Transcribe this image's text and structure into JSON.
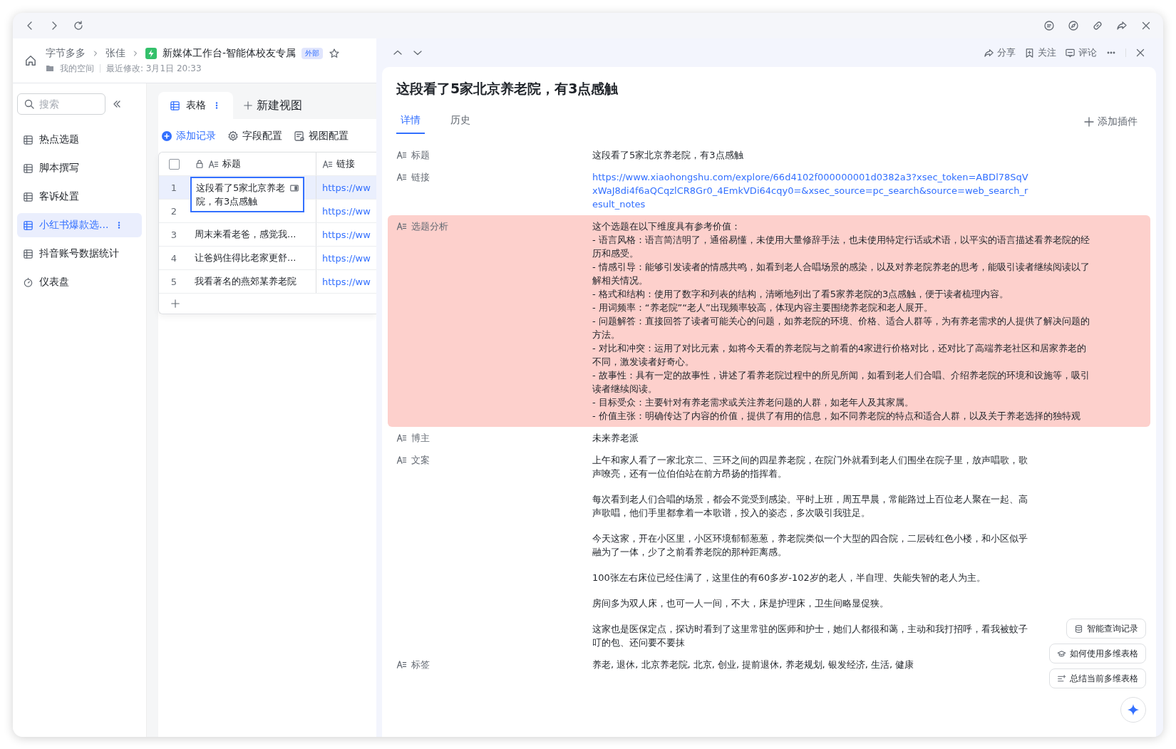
{
  "breadcrumb": {
    "items": [
      "字节多多",
      "张佳",
      "新媒体工作台-智能体校友专属"
    ],
    "badge": "外部",
    "location": "我的空间",
    "modified": "最近修改: 3月1日 20:33"
  },
  "sidebar": {
    "search": {
      "placeholder": "搜索"
    },
    "items": [
      {
        "label": "热点选题",
        "kind": "table",
        "selected": false
      },
      {
        "label": "脚本撰写",
        "kind": "table",
        "selected": false
      },
      {
        "label": "客诉处置",
        "kind": "table",
        "selected": false
      },
      {
        "label": "小红书爆款选...",
        "kind": "table",
        "selected": true
      },
      {
        "label": "抖音账号数据统计",
        "kind": "table",
        "selected": false
      },
      {
        "label": "仪表盘",
        "kind": "dashboard",
        "selected": false
      }
    ]
  },
  "views": [
    {
      "label": "表格",
      "selected": true
    }
  ],
  "new_view": "新建视图",
  "toolbar": [
    {
      "label": "添加记录",
      "kind": "add"
    },
    {
      "label": "字段配置",
      "kind": "fields"
    },
    {
      "label": "视图配置",
      "kind": "view"
    }
  ],
  "table": {
    "select_all": {
      "checked": false
    },
    "columns": [
      "标题",
      "链接"
    ],
    "rows": [
      {
        "number": "1",
        "title": "这段看了5家北京养老院，有3点感触",
        "link": "https://ww",
        "selected": true
      },
      {
        "number": "2",
        "link": "https://ww",
        "selected": false
      },
      {
        "number": "3",
        "title": "周末来看老爸，感觉我...",
        "link": "https://ww",
        "selected": false
      },
      {
        "number": "4",
        "title": "让爸妈住得比老家更舒...",
        "link": "https://ww",
        "selected": false
      },
      {
        "number": "5",
        "title": "我看著名的燕郊某养老院",
        "link": "https://ww",
        "selected": false
      }
    ]
  },
  "detail": {
    "actions": [
      "分享",
      "关注",
      "评论"
    ],
    "title": "这段看了5家北京养老院，有3点感触",
    "tabs": [
      {
        "label": "详情",
        "selected": true
      },
      {
        "label": "历史",
        "selected": false
      }
    ],
    "add_plugin": "添加插件",
    "fields": [
      {
        "label": "标题",
        "kind": "text",
        "highlighted": false,
        "paragraphs": [
          "这段看了5家北京养老院，有3点感触"
        ]
      },
      {
        "label": "链接",
        "kind": "link",
        "highlighted": false,
        "paragraphs": [
          "https://www.xiaohongshu.com/explore/66d4102f000000001d0382a3?xsec_token=ABDl78SqVxWaJ8di4f6aQCqzlCR8Gr0_4EmkVDi64cqy0=&xsec_source=pc_search&source=web_search_result_notes"
        ]
      },
      {
        "label": "选题分析",
        "kind": "lines",
        "highlighted": true,
        "paragraphs": [
          "这个选题在以下维度具有参考价值：",
          "- 语言风格：语言简洁明了，通俗易懂，未使用大量修辞手法，也未使用特定行话或术语，以平实的语言描述看养老院的经历和感受。",
          "- 情感引导：能够引发读者的情感共鸣，如看到老人合唱场景的感染，以及对养老院养老的思考，能吸引读者继续阅读以了解相关情况。",
          "- 格式和结构：使用了数字和列表的结构，清晰地列出了看5家养老院的3点感触，便于读者梳理内容。",
          "- 用词频率：“养老院”“老人”出现频率较高，体现内容主要围绕养老院和老人展开。",
          "- 问题解答：直接回答了读者可能关心的问题，如养老院的环境、价格、适合人群等，为有养老需求的人提供了解决问题的方法。",
          "- 对比和冲突：运用了对比元素，如将今天看的养老院与之前看的4家进行价格对比，还对比了高端养老社区和居家养老的不同，激发读者好奇心。",
          "- 故事性：具有一定的故事性，讲述了看养老院过程中的所见所闻，如看到老人们合唱、介绍养老院的环境和设施等，吸引读者继续阅读。",
          "- 目标受众：主要针对有养老需求或关注养老问题的人群，如老年人及其家属。",
          "- 价值主张：明确传达了内容的价值，提供了有用的信息，如不同养老院的特点和适合人群，以及关于养老选择的独特观"
        ]
      },
      {
        "label": "博主",
        "kind": "text",
        "highlighted": false,
        "paragraphs": [
          "未来养老派"
        ]
      },
      {
        "label": "文案",
        "kind": "text",
        "highlighted": false,
        "paragraphs": [
          "上午和家人看了一家北京二、三环之间的四星养老院，在院门外就看到老人们围坐在院子里，放声唱歌，歌声嘹亮，还有一位伯伯站在前方昂扬的指挥着。",
          "每次看到老人们合唱的场景，都会不觉受到感染。平时上班，周五早晨，常能路过上百位老人聚在一起、高声歌唱，他们手里都拿着一本歌谱，投入的姿态，多次吸引我驻足。",
          "今天这家，开在小区里，小区环境郁郁葱葱，养老院类似一个大型的四合院，二层砖红色小楼，和小区似乎融为了一体，少了之前看养老院的那种距离感。",
          "100张左右床位已经住满了，这里住的有60多岁-102岁的老人，半自理、失能失智的老人为主。",
          "房间多为双人床，也可一人一间，不大，床是护理床，卫生间略显促狭。",
          "这家也是医保定点，探访时看到了这里常驻的医师和护士，她们人都很和蔼，主动和我打招呼，看我被蚊子叮的包、还问要不要抹"
        ]
      },
      {
        "label": "标签",
        "kind": "text",
        "highlighted": false,
        "paragraphs": [
          "养老, 退休, 北京养老院, 北京, 创业, 提前退休, 养老规划, 银发经济, 生活, 健康"
        ]
      }
    ]
  },
  "assistant_buttons": [
    {
      "label": "智能查询记录",
      "kind": "query"
    },
    {
      "label": "如何使用多维表格",
      "kind": "help"
    },
    {
      "label": "总结当前多维表格",
      "kind": "summary"
    }
  ]
}
